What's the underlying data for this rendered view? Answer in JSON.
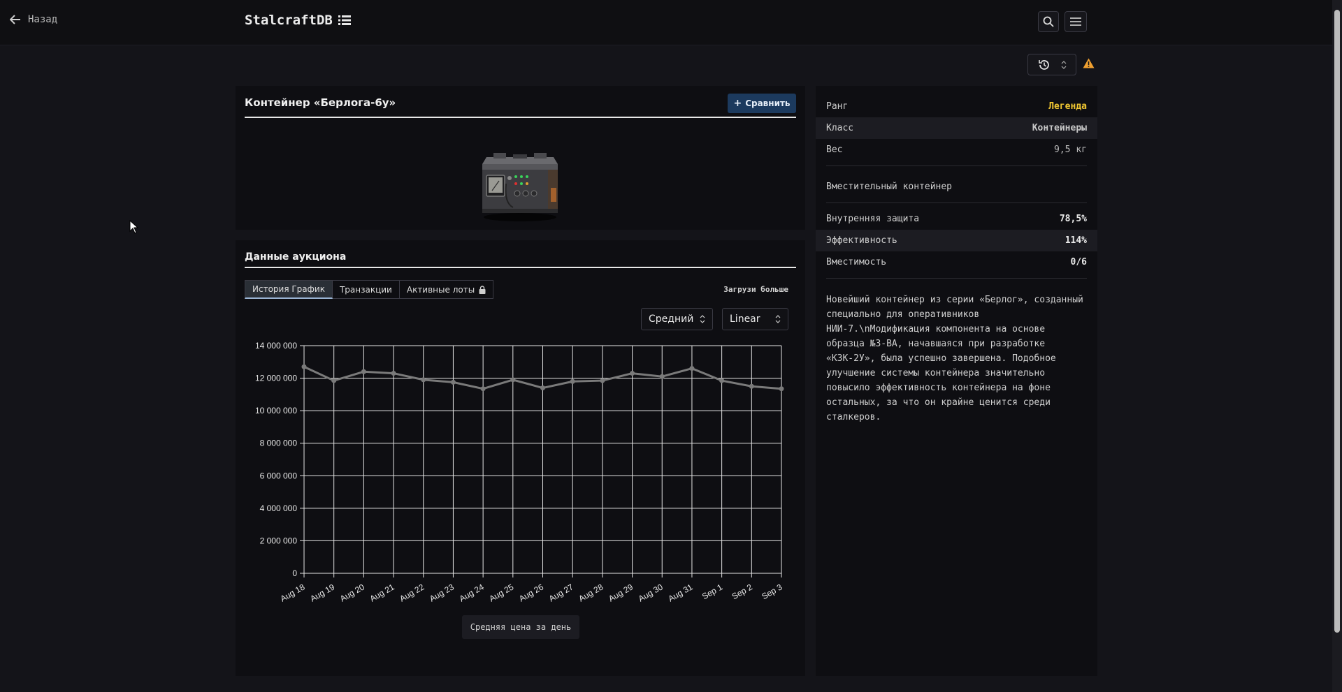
{
  "nav": {
    "back_label": "Назад",
    "brand": "StalcraftDB"
  },
  "item": {
    "title": "Контейнер «Берлога-6у»",
    "compare_label": "Сравнить"
  },
  "auction": {
    "title": "Данные аукциона",
    "tabs": [
      "История График",
      "Транзакции",
      "Активные лоты"
    ],
    "load_more": "Загрузи больше",
    "aggregate_select": "Средний",
    "scale_select": "Linear",
    "caption": "Средняя цена за день"
  },
  "chart_data": {
    "type": "line",
    "categories": [
      "Aug 18",
      "Aug 19",
      "Aug 20",
      "Aug 21",
      "Aug 22",
      "Aug 23",
      "Aug 24",
      "Aug 25",
      "Aug 26",
      "Aug 27",
      "Aug 28",
      "Aug 29",
      "Aug 30",
      "Aug 31",
      "Sep 1",
      "Sep 2",
      "Sep 3"
    ],
    "values": [
      12700000,
      11850000,
      12400000,
      12300000,
      11900000,
      11750000,
      11350000,
      11900000,
      11400000,
      11800000,
      11850000,
      12300000,
      12100000,
      12600000,
      11850000,
      11500000,
      11350000
    ],
    "ylim": [
      0,
      14000000
    ],
    "yticks": [
      "0",
      "2 000 000",
      "4 000 000",
      "6 000 000",
      "8 000 000",
      "10 000 000",
      "12 000 000",
      "14 000 000"
    ],
    "grid": true,
    "color": "#7a7a7a"
  },
  "info": {
    "rank_label": "Ранг",
    "rank_value": "Легенда",
    "class_label": "Класс",
    "class_value": "Контейнеры",
    "weight_label": "Вес",
    "weight_value": "9,5 кг",
    "subtitle": "Вместительный контейнер",
    "protection_label": "Внутренняя защита",
    "protection_value": "78,5%",
    "efficiency_label": "Эффективность",
    "efficiency_value": "114%",
    "capacity_label": "Вместимость",
    "capacity_value": "0/6",
    "description": "Новейший контейнер из серии «Берлог», созданный специально для оперативников НИИ-7.\\nМодификация компонента на основе образца №3-ВА, начавшаяся при разработке «КЗК-2У», была успешно завершена. Подобное улучшение системы контейнера значительно повысило эффективность контейнера на фоне остальных, за что он крайне ценится среди сталкеров."
  },
  "colors": {
    "accent_gold": "#f2c832",
    "compare_bg": "#1c3a5e",
    "warning": "#f0a030"
  }
}
